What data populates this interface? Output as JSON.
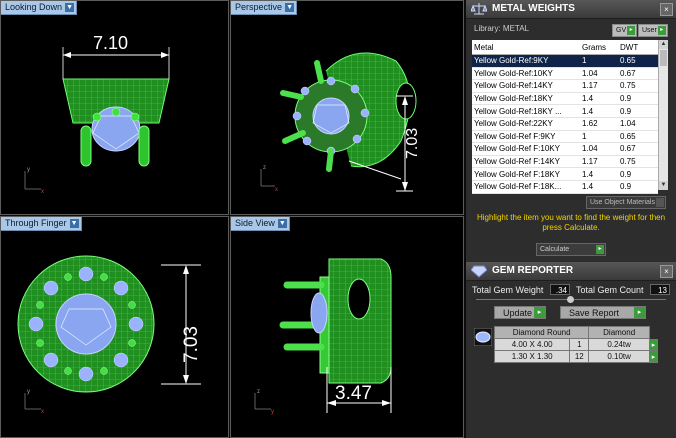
{
  "viewports": {
    "top_left": {
      "label": "Looking Down",
      "dimension": "7.10"
    },
    "top_right": {
      "label": "Perspective",
      "dimension": "7.03"
    },
    "bottom_left": {
      "label": "Through Finger",
      "dimension": "7.03"
    },
    "bottom_right": {
      "label": "Side View",
      "dimension": "3.47"
    }
  },
  "metal_panel": {
    "title": "METAL WEIGHTS",
    "library_label": "Library: METAL",
    "gv_button": "GV",
    "user_button": "User",
    "columns": [
      "Metal",
      "Grams",
      "DWT"
    ],
    "rows": [
      [
        "Yellow Gold-Ref:9KY",
        "1",
        "0.65"
      ],
      [
        "Yellow Gold-Ref:10KY",
        "1.04",
        "0.67"
      ],
      [
        "Yellow Gold-Ref:14KY",
        "1.17",
        "0.75"
      ],
      [
        "Yellow Gold-Ref:18KY",
        "1.4",
        "0.9"
      ],
      [
        "Yellow Gold-Ref:18KY ...",
        "1.4",
        "0.9"
      ],
      [
        "Yellow Gold-Ref:22KY",
        "1.62",
        "1.04"
      ],
      [
        "Yellow Gold-Ref F:9KY",
        "1",
        "0.65"
      ],
      [
        "Yellow Gold-Ref F:10KY",
        "1.04",
        "0.67"
      ],
      [
        "Yellow Gold-Ref F:14KY",
        "1.17",
        "0.75"
      ],
      [
        "Yellow Gold-Ref F:18KY",
        "1.4",
        "0.9"
      ],
      [
        "Yellow Gold-Ref F:18K...",
        "1.4",
        "0.9"
      ]
    ],
    "use_object_materials": "Use Object Materials",
    "hint": "Highlight the item you want to find the weight for then press Calculate.",
    "calculate_label": "Calculate"
  },
  "gem_panel": {
    "title": "GEM REPORTER",
    "total_weight_label": "Total Gem Weight",
    "total_weight_value": ".34",
    "total_count_label": "Total Gem Count",
    "total_count_value": "13",
    "update_label": "Update",
    "save_report_label": "Save Report",
    "header": [
      "Diamond Round",
      "Diamond"
    ],
    "rows": [
      [
        "4.00 X 4.00",
        "1",
        "0.24tw"
      ],
      [
        "1.30 X 1.30",
        "12",
        "0.10tw"
      ]
    ]
  },
  "colors": {
    "model_green": "#3fe03f",
    "gem_blue": "#8aa6f0",
    "highlight_yellow": "#f5d400",
    "selection_navy": "#10244a"
  }
}
